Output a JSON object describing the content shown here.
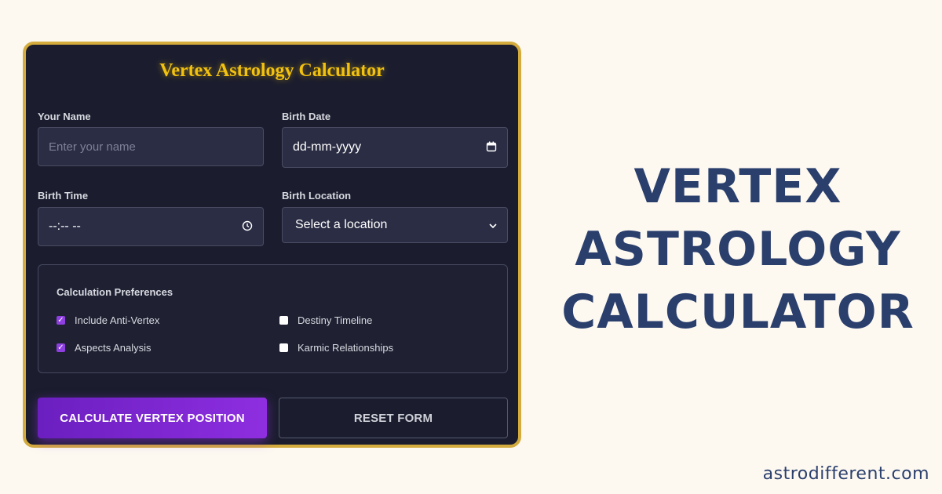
{
  "card": {
    "title": "Vertex Astrology Calculator",
    "fields": {
      "name": {
        "label": "Your Name",
        "placeholder": "Enter your name"
      },
      "date": {
        "label": "Birth Date",
        "value": "dd-mm-yyyy",
        "icon": "calendar-icon"
      },
      "time": {
        "label": "Birth Time",
        "value": "--:-- --",
        "icon": "clock-icon"
      },
      "location": {
        "label": "Birth Location",
        "value": "Select a location",
        "icon": "chevron-down-icon"
      }
    },
    "preferences": {
      "title": "Calculation Preferences",
      "options": [
        {
          "label": "Include Anti-Vertex",
          "checked": true
        },
        {
          "label": "Destiny Timeline",
          "checked": false
        },
        {
          "label": "Aspects Analysis",
          "checked": true
        },
        {
          "label": "Karmic Relationships",
          "checked": false
        }
      ]
    },
    "buttons": {
      "calculate": "CALCULATE VERTEX POSITION",
      "reset": "RESET FORM"
    }
  },
  "headline": {
    "line1": "VERTEX",
    "line2": "ASTROLOGY",
    "line3": "CALCULATOR"
  },
  "footer": {
    "site": "astrodifferent.com"
  },
  "colors": {
    "background": "#fdf9f1",
    "card_bg": "#1b1d2e",
    "card_border": "#d4ab3d",
    "title_gold": "#f3c20f",
    "accent_purple": "#8e2ee0",
    "headline_navy": "#2b3f6d"
  }
}
